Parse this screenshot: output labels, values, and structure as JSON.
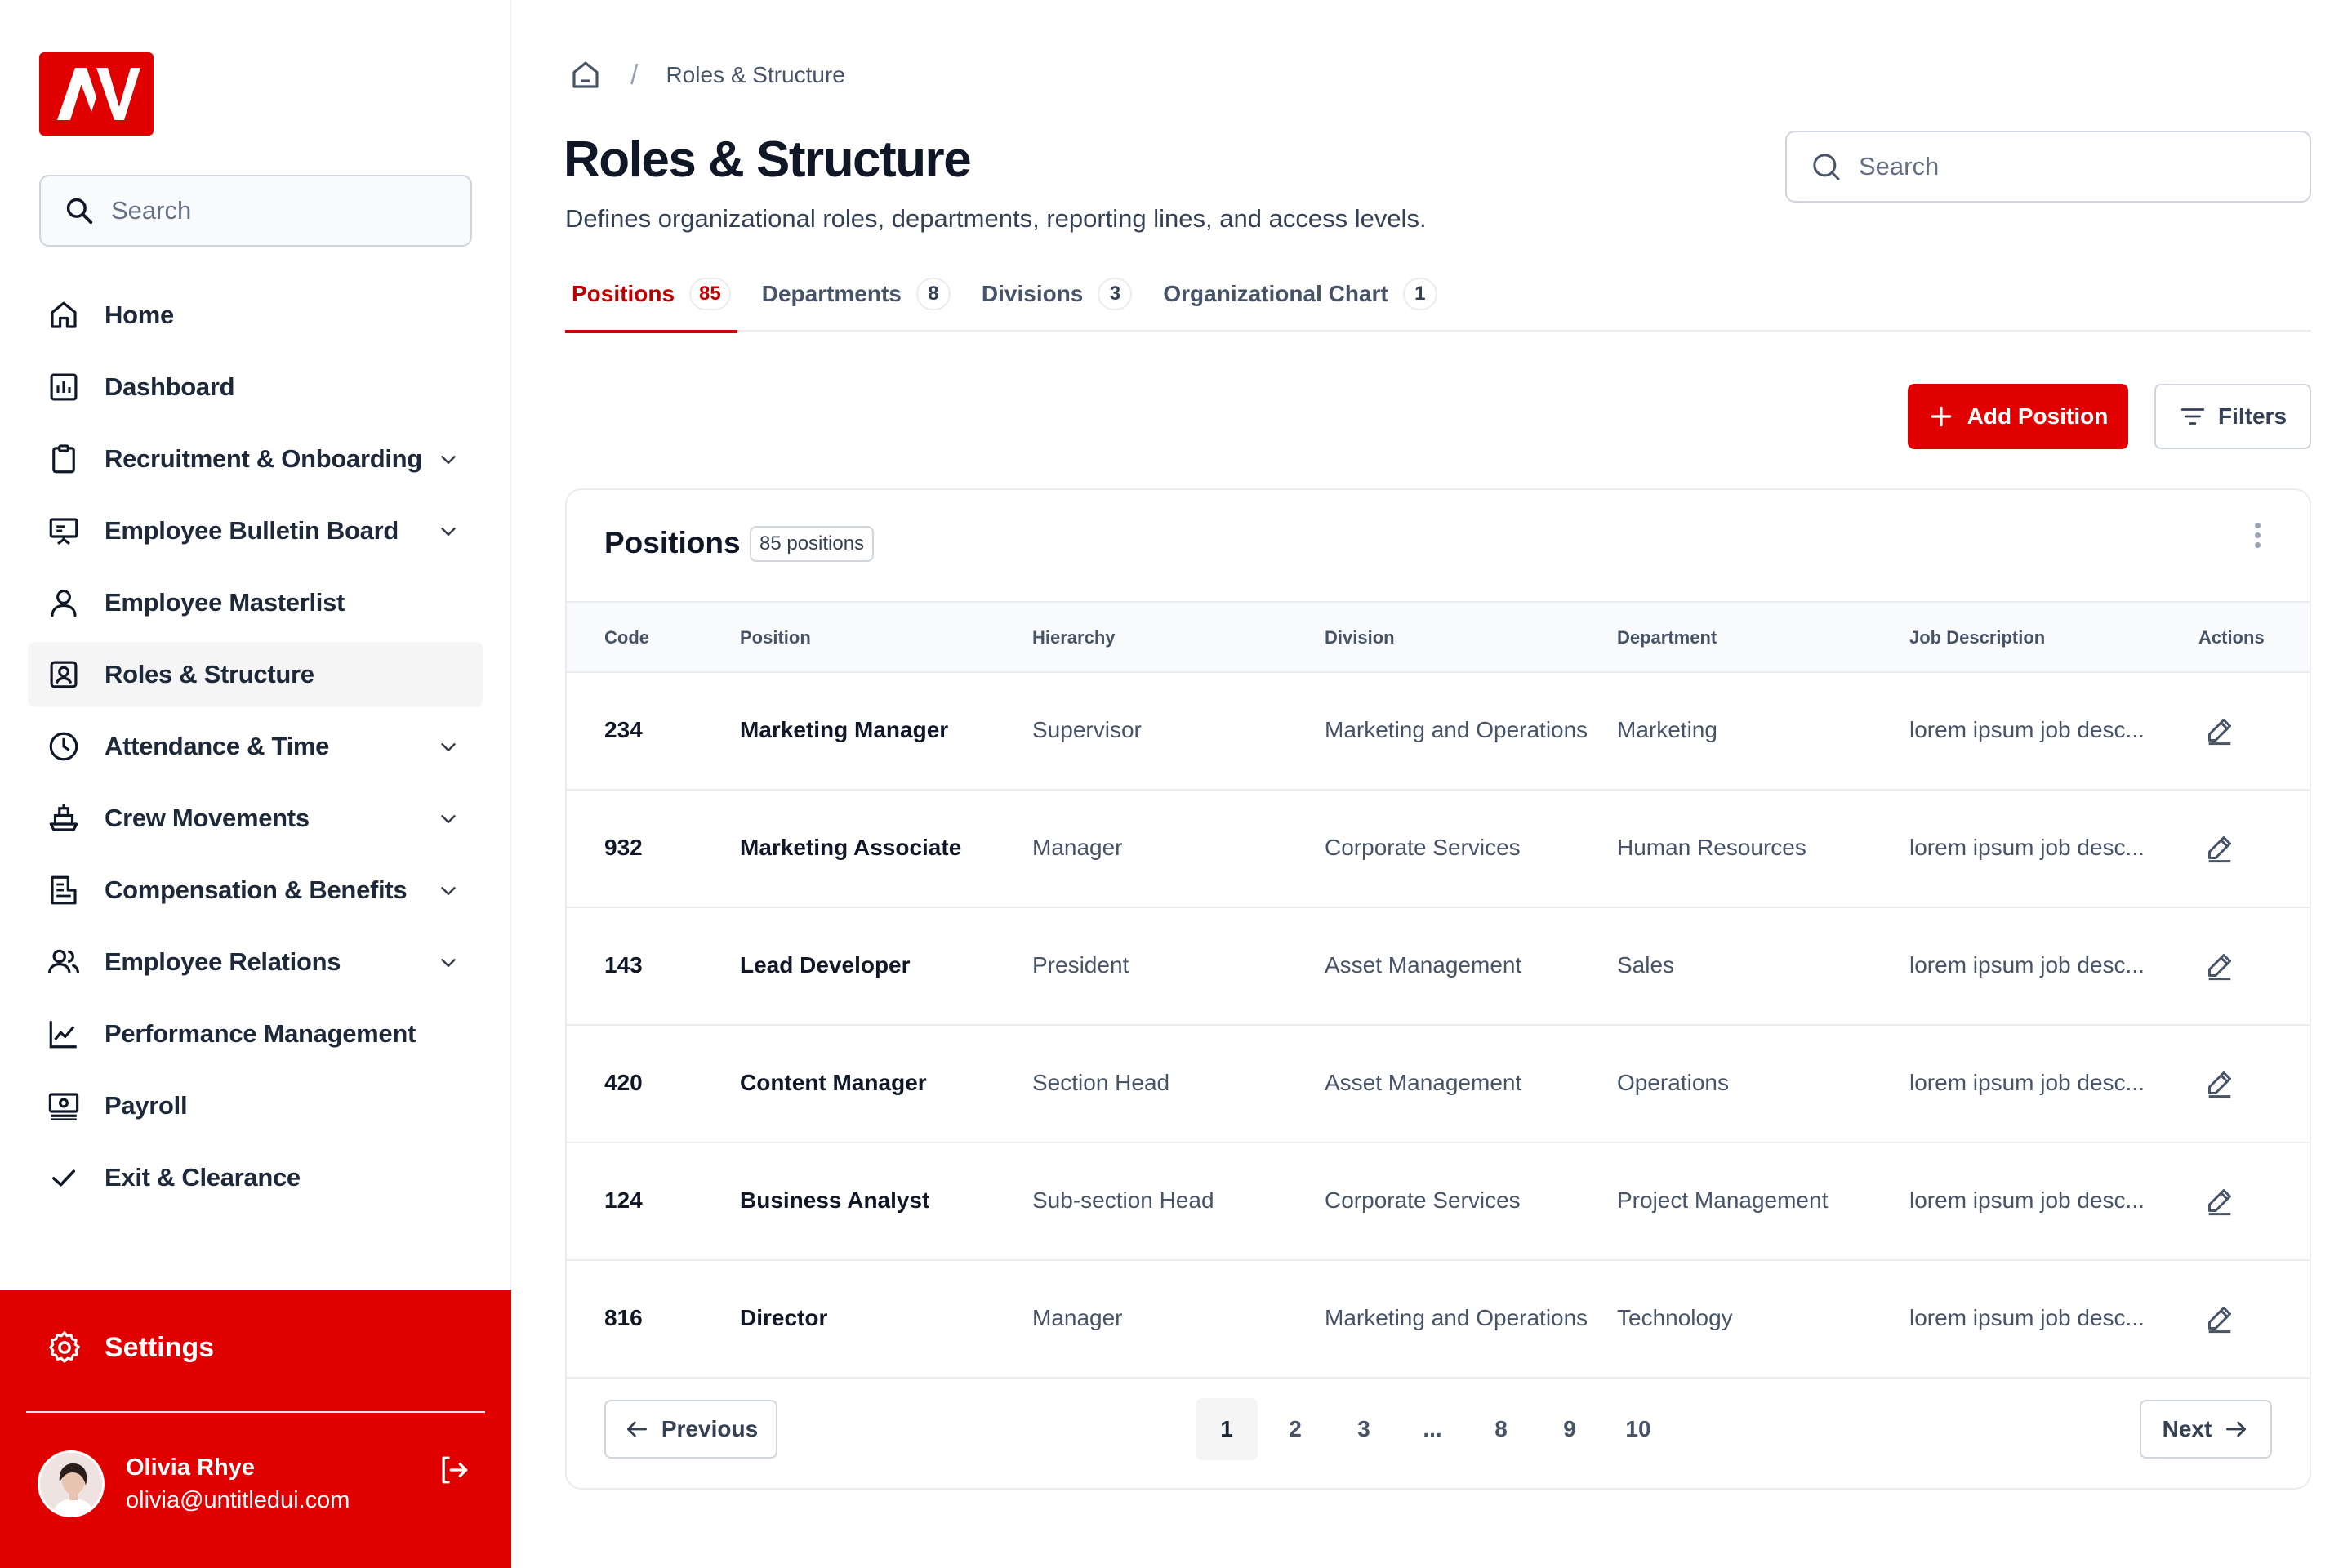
{
  "sidebar": {
    "search_placeholder": "Search",
    "items": [
      {
        "label": "Home",
        "icon": "home-icon"
      },
      {
        "label": "Dashboard",
        "icon": "chart-icon"
      },
      {
        "label": "Recruitment & Onboarding",
        "icon": "clipboard-icon"
      },
      {
        "label": "Employee Bulletin Board",
        "icon": "presentation-icon"
      },
      {
        "label": "Employee Masterlist",
        "icon": "user-icon"
      },
      {
        "label": "Roles & Structure",
        "icon": "user-square-icon"
      },
      {
        "label": "Attendance & Time",
        "icon": "clock-icon"
      },
      {
        "label": "Crew Movements",
        "icon": "ship-icon"
      },
      {
        "label": "Compensation & Benefits",
        "icon": "receipt-icon"
      },
      {
        "label": "Employee Relations",
        "icon": "users-icon"
      },
      {
        "label": "Performance Management",
        "icon": "line-chart-icon"
      },
      {
        "label": "Payroll",
        "icon": "money-icon"
      },
      {
        "label": "Exit & Clearance",
        "icon": "check-icon"
      }
    ],
    "settings_label": "Settings",
    "user": {
      "name": "Olivia Rhye",
      "email": "olivia@untitledui.com"
    }
  },
  "breadcrumb": {
    "current": "Roles & Structure"
  },
  "header": {
    "title": "Roles & Structure",
    "subtitle": "Defines organizational roles, departments, reporting lines, and access levels.",
    "search_placeholder": "Search"
  },
  "tabs": [
    {
      "label": "Positions",
      "count": "85"
    },
    {
      "label": "Departments",
      "count": "8"
    },
    {
      "label": "Divisions",
      "count": "3"
    },
    {
      "label": "Organizational Chart",
      "count": "1"
    }
  ],
  "actions": {
    "add_label": "Add Position",
    "filters_label": "Filters"
  },
  "table": {
    "title": "Positions",
    "badge": "85 positions",
    "columns": [
      "Code",
      "Position",
      "Hierarchy",
      "Division",
      "Department",
      "Job Description",
      "Actions"
    ],
    "rows": [
      [
        "234",
        "Marketing Manager",
        "Supervisor",
        "Marketing and Operations",
        "Marketing",
        "lorem ipsum job desc..."
      ],
      [
        "932",
        "Marketing Associate",
        "Manager",
        "Corporate Services",
        "Human Resources",
        "lorem ipsum job desc..."
      ],
      [
        "143",
        "Lead Developer",
        "President",
        "Asset Management",
        "Sales",
        "lorem ipsum job desc..."
      ],
      [
        "420",
        "Content Manager",
        "Section Head",
        "Asset Management",
        "Operations",
        "lorem ipsum job desc..."
      ],
      [
        "124",
        "Business Analyst",
        "Sub-section Head",
        "Corporate Services",
        "Project Management",
        "lorem ipsum job desc..."
      ],
      [
        "816",
        "Director",
        "Manager",
        "Marketing and Operations",
        "Technology",
        "lorem ipsum job desc..."
      ]
    ]
  },
  "pagination": {
    "previous_label": "Previous",
    "next_label": "Next",
    "pages": [
      "1",
      "2",
      "3",
      "...",
      "8",
      "9",
      "10"
    ]
  },
  "colors": {
    "brand": "#e00000",
    "text": "#101828",
    "muted": "#475467",
    "border": "#eaecf0"
  }
}
